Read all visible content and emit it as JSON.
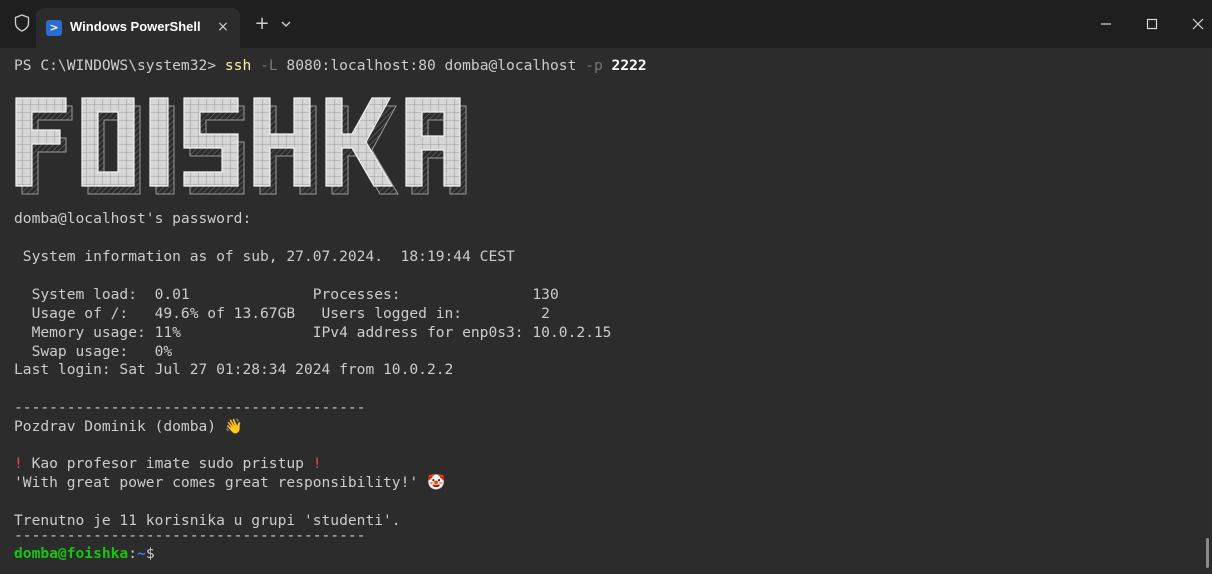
{
  "window": {
    "tab_title": "Windows PowerShell",
    "tab_close": "×",
    "new_tab": "+"
  },
  "terminal": {
    "prompt_ps": "PS C:\\WINDOWS\\system32> ",
    "cmd_name": "ssh",
    "cmd_flag_L": "-L",
    "cmd_forward": "8080:localhost:80 domba@localhost",
    "cmd_flag_p": "-p",
    "cmd_port": "2222",
    "banner_text": "FOISHKA",
    "password_prompt": "domba@localhost's password:",
    "sysinfo_header": " System information as of sub, 27.07.2024.  18:19:44 CEST",
    "stats": [
      "  System load:  0.01              Processes:               130",
      "  Usage of /:   49.6% of 13.67GB   Users logged in:         2",
      "  Memory usage: 11%               IPv4 address for enp0s3: 10.0.2.15",
      "  Swap usage:   0%"
    ],
    "last_login": "Last login: Sat Jul 27 01:28:34 2024 from 10.0.2.2",
    "separator": "----------------------------------------",
    "greeting": "Pozdrav Dominik (domba) ",
    "sudo_line": " Kao profesor imate sudo pristup ",
    "quote": "'With great power comes great responsibility!' ",
    "group_info": "Trenutno je 11 korisnika u grupi 'studenti'.",
    "prompt_user": "domba@foishka",
    "prompt_colon": ":",
    "prompt_path": "~",
    "prompt_dollar": "$ "
  }
}
